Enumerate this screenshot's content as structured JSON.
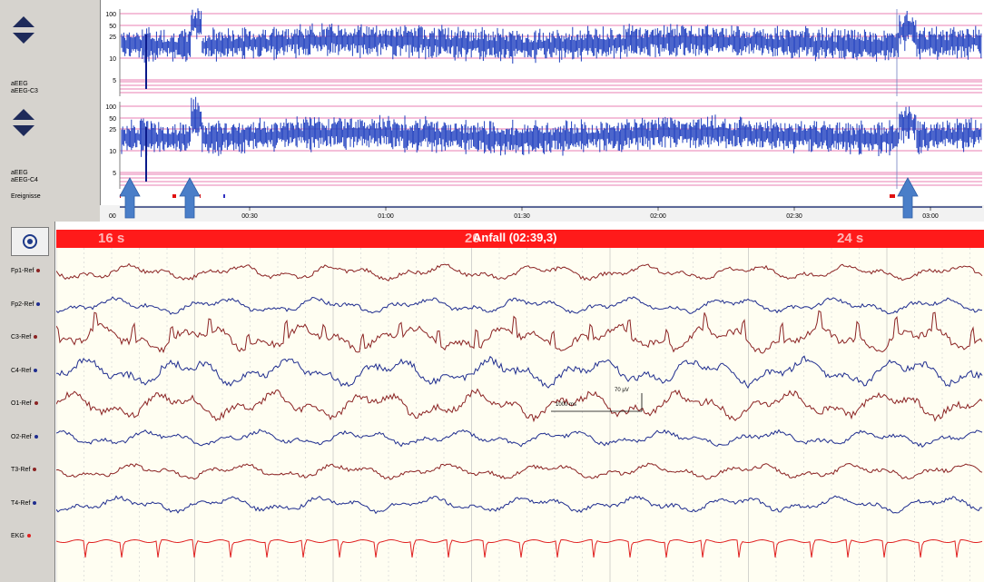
{
  "trend_panels": [
    {
      "id": "c3",
      "label1": "aEEG",
      "label2": "aEEG-C3",
      "scale_ticks": [
        "100",
        "50",
        "25",
        "10",
        "5"
      ]
    },
    {
      "id": "c4",
      "label1": "aEEG",
      "label2": "aEEG-C4",
      "scale_ticks": [
        "100",
        "50",
        "25",
        "10",
        "5"
      ]
    }
  ],
  "events_label": "Ereignisse",
  "time_axis": [
    "00:30",
    "01:00",
    "01:30",
    "02:00",
    "02:30",
    "03:00"
  ],
  "time_axis_start": "00",
  "banner": {
    "event_label": "Anfall (02:39,3)",
    "sec_left": "16 s",
    "sec_mid": "20",
    "sec_right": "24 s"
  },
  "channels": [
    {
      "label": "Fp1-Ref",
      "color": "#8b2323"
    },
    {
      "label": "Fp2-Ref",
      "color": "#1f2d8f"
    },
    {
      "label": "C3-Ref",
      "color": "#8b2323"
    },
    {
      "label": "C4-Ref",
      "color": "#1f2d8f"
    },
    {
      "label": "O1-Ref",
      "color": "#8b2323"
    },
    {
      "label": "O2-Ref",
      "color": "#1f2d8f"
    },
    {
      "label": "T3-Ref",
      "color": "#8b2323"
    },
    {
      "label": "T4-Ref",
      "color": "#1f2d8f"
    },
    {
      "label": "EKG",
      "color": "#e02020"
    }
  ],
  "calibration": {
    "time": "1000 ms",
    "amp": "70 µV"
  },
  "colors": {
    "trend": "#1f3fbf",
    "grid_pink": "#e0559a",
    "banner": "#ff1a1a",
    "raw_bg": "#fffef2",
    "arrow": "#4a7ec8"
  }
}
